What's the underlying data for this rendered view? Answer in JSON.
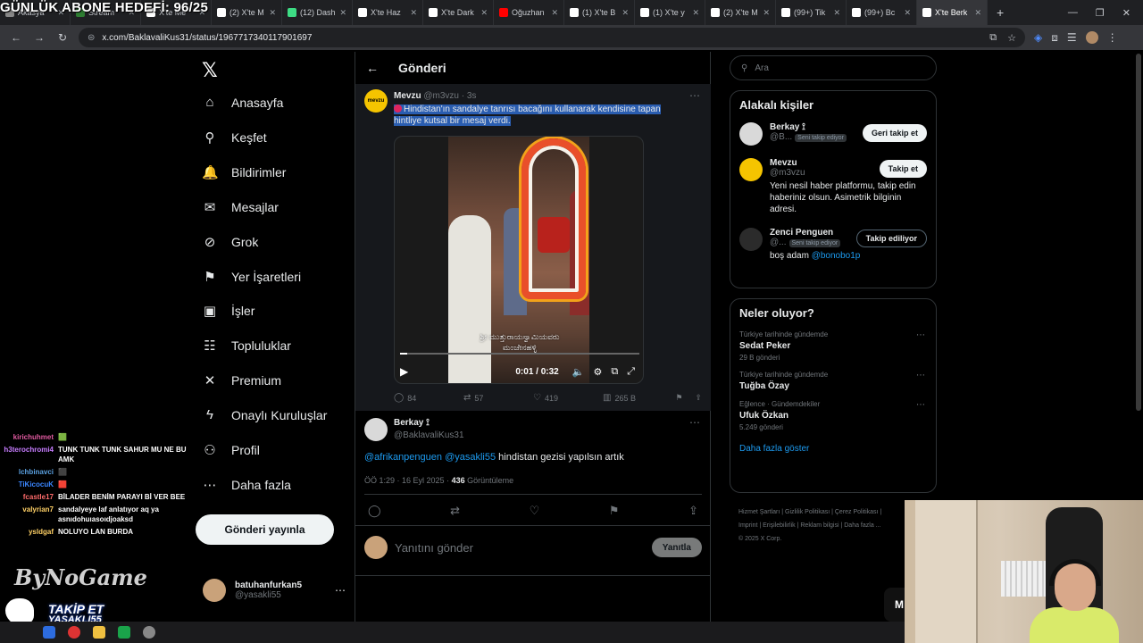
{
  "overlay": {
    "goal": "GÜNLÜK ABONE HEDEFİ: 96/25"
  },
  "browser": {
    "tabs": [
      {
        "label": "Akasya",
        "color": "#888"
      },
      {
        "label": "Stream",
        "color": "#2e7d32"
      },
      {
        "label": "X'te Me",
        "color": "#fff"
      },
      {
        "label": "(2) X'te M",
        "color": "#fff"
      },
      {
        "label": "(12) Dash",
        "color": "#3ddc84"
      },
      {
        "label": "X'te Haz",
        "color": "#fff"
      },
      {
        "label": "X'te Dark",
        "color": "#fff"
      },
      {
        "label": "Oğuzhan",
        "color": "#ff0000"
      },
      {
        "label": "(1) X'te B",
        "color": "#fff"
      },
      {
        "label": "(1) X'te y",
        "color": "#fff"
      },
      {
        "label": "(2) X'te M",
        "color": "#fff"
      },
      {
        "label": "(99+) Tik",
        "color": "#fff"
      },
      {
        "label": "(99+) Bc",
        "color": "#fff"
      },
      {
        "label": "X'te Berk",
        "color": "#fff"
      }
    ],
    "url": "x.com/BaklavaliKus31/status/1967717340117901697"
  },
  "nav": {
    "items": [
      {
        "label": "Anasayfa",
        "icon": "⌂"
      },
      {
        "label": "Keşfet",
        "icon": "⚲"
      },
      {
        "label": "Bildirimler",
        "icon": "🔔"
      },
      {
        "label": "Mesajlar",
        "icon": "✉"
      },
      {
        "label": "Grok",
        "icon": "⊘"
      },
      {
        "label": "Yer İşaretleri",
        "icon": "⚑"
      },
      {
        "label": "İşler",
        "icon": "▣"
      },
      {
        "label": "Topluluklar",
        "icon": "☷"
      },
      {
        "label": "Premium",
        "icon": "✕"
      },
      {
        "label": "Onaylı Kuruluşlar",
        "icon": "ϟ"
      },
      {
        "label": "Profil",
        "icon": "⚇"
      },
      {
        "label": "Daha fazla",
        "icon": "⋯"
      }
    ],
    "post_button": "Gönderi yayınla",
    "me": {
      "name": "batuhanfurkan5",
      "handle": "@yasakli55"
    }
  },
  "main": {
    "title": "Gönderi",
    "quoted": {
      "avatar_text": "mevzu",
      "name": "Mevzu",
      "handle": "@m3vzu",
      "time": "· 3s",
      "text_plain": "Hindistan'ın sa",
      "text_selected": "ndalye tanrısı bacağını kullanarak kendisine tapan hintliye kutsal bir mesaj verdi.",
      "video_caption": "ಶ್ರೀ ಮುತ್ತುರಾಯಸ್ವಾಮಿಯವರು ಮಂಜೇನಹಳ್ಳಿ",
      "video_time": "0:01 / 0:32",
      "video_progress": 0.03,
      "stats": {
        "replies": "84",
        "reposts": "57",
        "likes": "419",
        "views": "265 B"
      }
    },
    "reply": {
      "name": "Berkay ⟟",
      "handle": "@BaklavaliKus31",
      "mention1": "@afrikanpenguen",
      "mention2": "@yasakli55",
      "text": "hindistan gezisi yapılsın artık",
      "time": "ÖÖ 1:29 · 16 Eyl 2025 ·",
      "views": "436",
      "views_label": "Görüntüleme"
    },
    "compose": {
      "placeholder": "Yanıtını gönder",
      "button": "Yanıtla"
    }
  },
  "right": {
    "search_placeholder": "Ara",
    "people_title": "Alakalı kişiler",
    "people": [
      {
        "name": "Berkay ⟟",
        "handle": "@B...",
        "badge": "Seni takip ediyor",
        "button": "Geri takip et",
        "bio": "",
        "color": "#d9d9d9"
      },
      {
        "name": "Mevzu",
        "handle": "@m3vzu",
        "badge": "",
        "button": "Takip et",
        "bio": "Yeni nesil haber platformu, takip edin haberiniz olsun. Asimetrik bilginin adresi.",
        "color": "#f5c400"
      },
      {
        "name": "Zenci Penguen",
        "handle": "@...",
        "badge": "Seni takip ediyor",
        "button": "Takip ediliyor",
        "bio": "boş adam",
        "bio_mention": "@bonobo1p",
        "color": "#2b2b2b"
      }
    ],
    "trends_title": "Neler oluyor?",
    "trends": [
      {
        "context": "Türkiye tarihinde gündemde",
        "name": "Sedat Peker",
        "posts": "29 B gönderi"
      },
      {
        "context": "Türkiye tarihinde gündemde",
        "name": "Tuğba Özay",
        "posts": ""
      },
      {
        "context": "Eğlence · Gündemdekiler",
        "name": "Ufuk Özkan",
        "posts": "5.249 gönderi"
      }
    ],
    "show_more": "Daha fazla göster",
    "footer_line1": "Hizmet Şartları  |  Gizlilik Politikası  |  Çerez Politikası  |",
    "footer_line2": "Imprint  |  Erişilebilirlik  |  Reklam bilgisi  |  Daha fazla ...",
    "footer_line3": "© 2025 X Corp."
  },
  "stream": {
    "chat": [
      {
        "user": "kirichuhmet",
        "msg": "🟩",
        "color": "#e05aa0"
      },
      {
        "user": "h3terochromi4",
        "msg": "TUNK TUNK TUNK SAHUR MU NE BU AMK",
        "color": "#c77dff"
      },
      {
        "user": "lchbinavci",
        "msg": "⬛",
        "color": "#5aa0e0"
      },
      {
        "user": "TiKicocuK",
        "msg": "🟥",
        "color": "#3a86ff"
      },
      {
        "user": "fcastle17",
        "msg": "BİLADER BENİM PARAYI Bİ VER BEE",
        "color": "#ff6b6b"
      },
      {
        "user": "valyrian7",
        "msg": "sandalyeye laf anlatıyor aq ya asnıdohuıasoıdjoaksd",
        "color": "#ffd166"
      },
      {
        "user": "ysldgaf",
        "msg": "NOLUYO LAN BURDA",
        "color": "#ffd166"
      }
    ],
    "brand": "ByNoGame",
    "takip": "TAKİP ET",
    "takip_sub": "YASAKLI55",
    "chip": "M"
  }
}
